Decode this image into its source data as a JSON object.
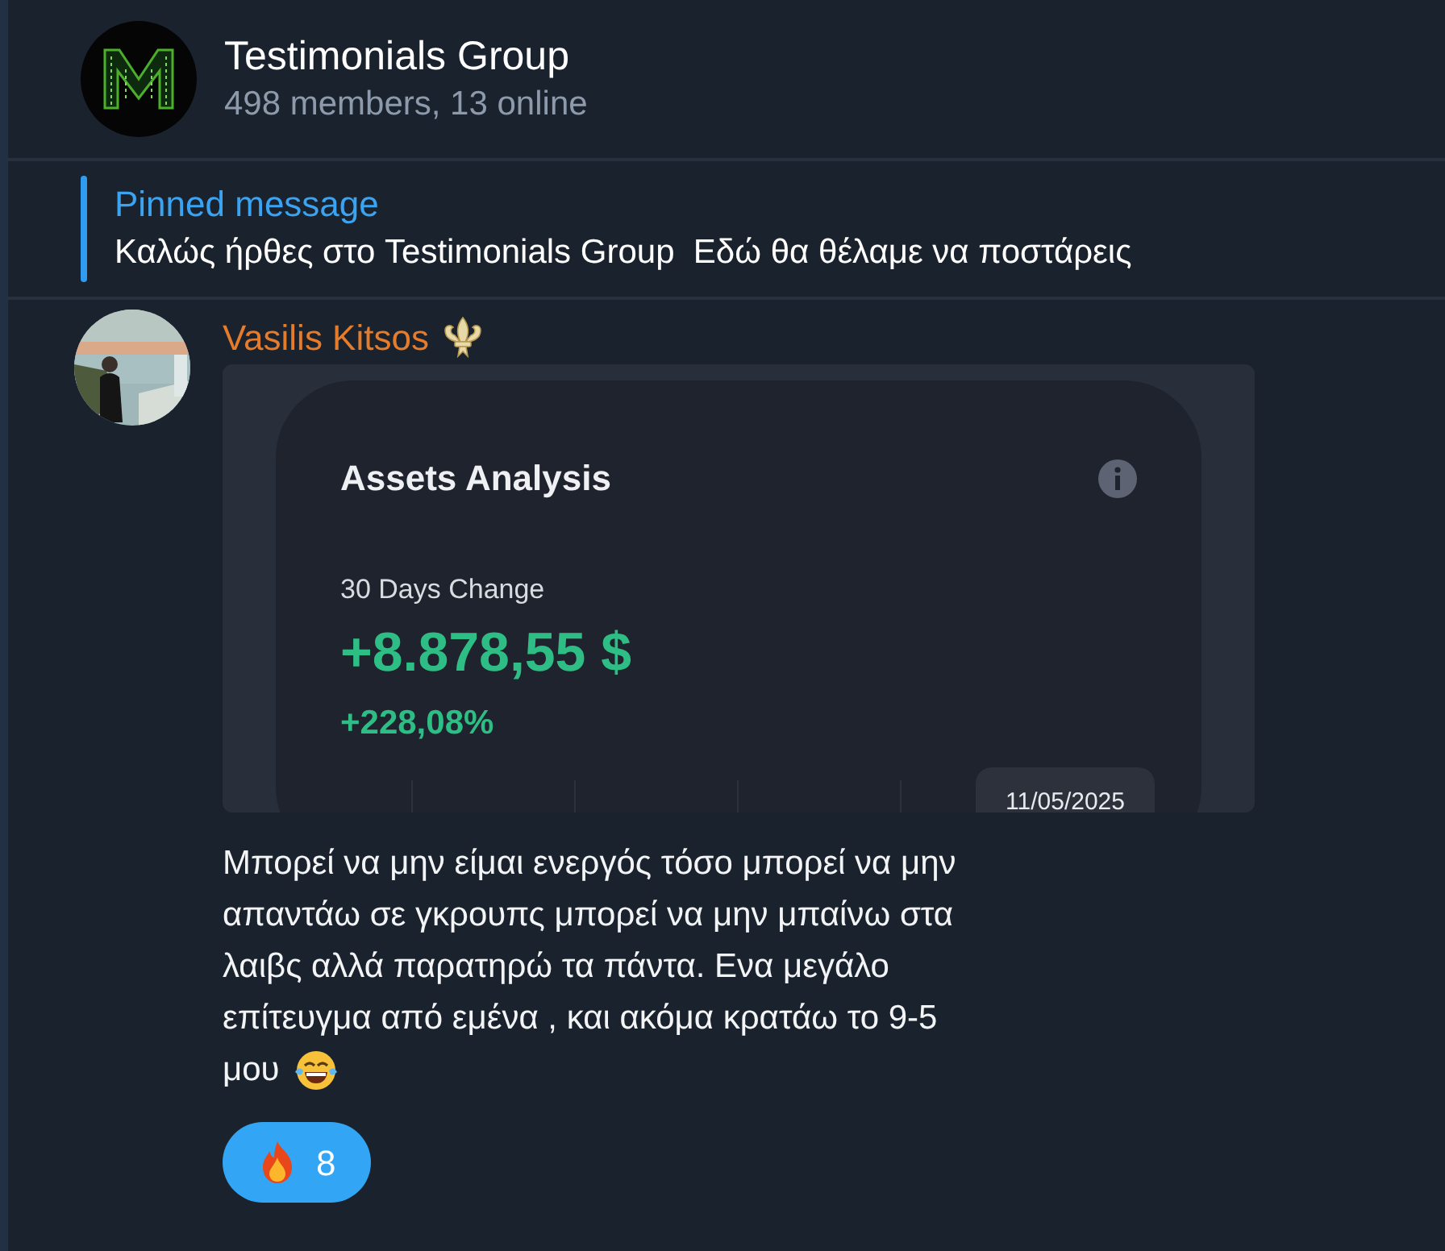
{
  "header": {
    "title": "Testimonials Group",
    "subtitle": "498 members, 13 online"
  },
  "pinned": {
    "label": "Pinned message",
    "text": "Καλώς ήρθες στο Testimonials Group  Εδώ θα θέλαμε να ποστάρεις"
  },
  "message": {
    "sender": "Vasilis Kitsos",
    "screenshot": {
      "title": "Assets Analysis",
      "change_label": "30 Days Change",
      "change_value": "+8.878,55 $",
      "change_percent": "+228,08%",
      "tooltip_date": "11/05/2025"
    },
    "text_lines": [
      "Μπορεί να μην είμαι ενεργός τόσο μπορεί να μην",
      "απαντάω σε γκρουπς μπορεί να μην μπαίνω στα",
      "λαιβς αλλά παρατηρώ τα πάντα. Ενα μεγάλο",
      "επίτευγμα από εμένα , και ακόμα κρατάω το 9-5",
      "μου"
    ],
    "reactions": [
      {
        "count": "8",
        "selected": true
      }
    ]
  }
}
